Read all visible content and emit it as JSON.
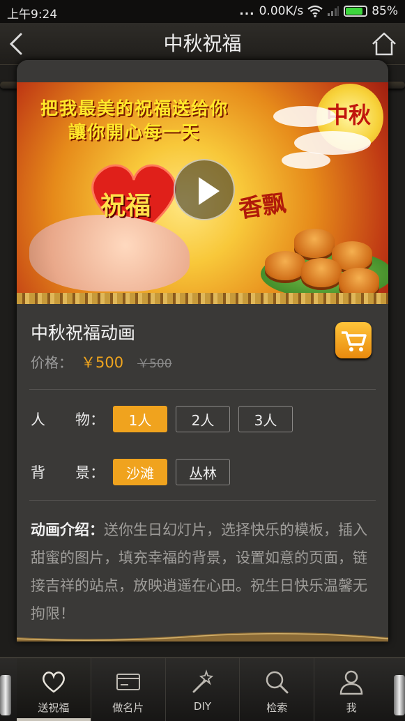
{
  "status_bar": {
    "time": "上午9:24",
    "signal_dots": "...",
    "speed": "0.00K/s",
    "battery_percent": "85%"
  },
  "title_bar": {
    "title": "中秋祝福",
    "back_icon": "back-chevron-icon",
    "home_icon": "home-icon"
  },
  "banner": {
    "line1": "把我最美的祝福送给你",
    "line2": "讓你開心每一天",
    "moon_text": "中秋",
    "heart_text": "祝福",
    "calligraphy": "香飘"
  },
  "product": {
    "name": "中秋祝福动画",
    "price_label": "价格：",
    "price": "￥500",
    "original_price": "￥500",
    "cart_icon": "cart-icon"
  },
  "options": {
    "characters": {
      "label_a": "人",
      "label_b": "物：",
      "choices": [
        "1人",
        "2人",
        "3人"
      ],
      "selected": "1人"
    },
    "background": {
      "label_a": "背",
      "label_b": "景：",
      "choices": [
        "沙滩",
        "丛林"
      ],
      "selected": "沙滩"
    }
  },
  "description": {
    "heading": "动画介绍：",
    "body": "送你生日幻灯片，选择快乐的模板，插入甜蜜的图片，填充幸福的背景，设置如意的页面，链接吉祥的站点，放映逍遥在心田。祝生日快乐温馨无拘限！"
  },
  "tab_bar": {
    "tabs": [
      {
        "label": "送祝福",
        "icon": "heart-icon"
      },
      {
        "label": "做名片",
        "icon": "card-icon"
      },
      {
        "label": "DIY",
        "icon": "magic-wand-icon"
      },
      {
        "label": "检索",
        "icon": "search-icon"
      },
      {
        "label": "我",
        "icon": "user-icon"
      }
    ],
    "active": "送祝福"
  },
  "colors": {
    "accent": "#f0a31e",
    "card_bg": "#3a3937",
    "page_bg": "#1e1d1b"
  }
}
